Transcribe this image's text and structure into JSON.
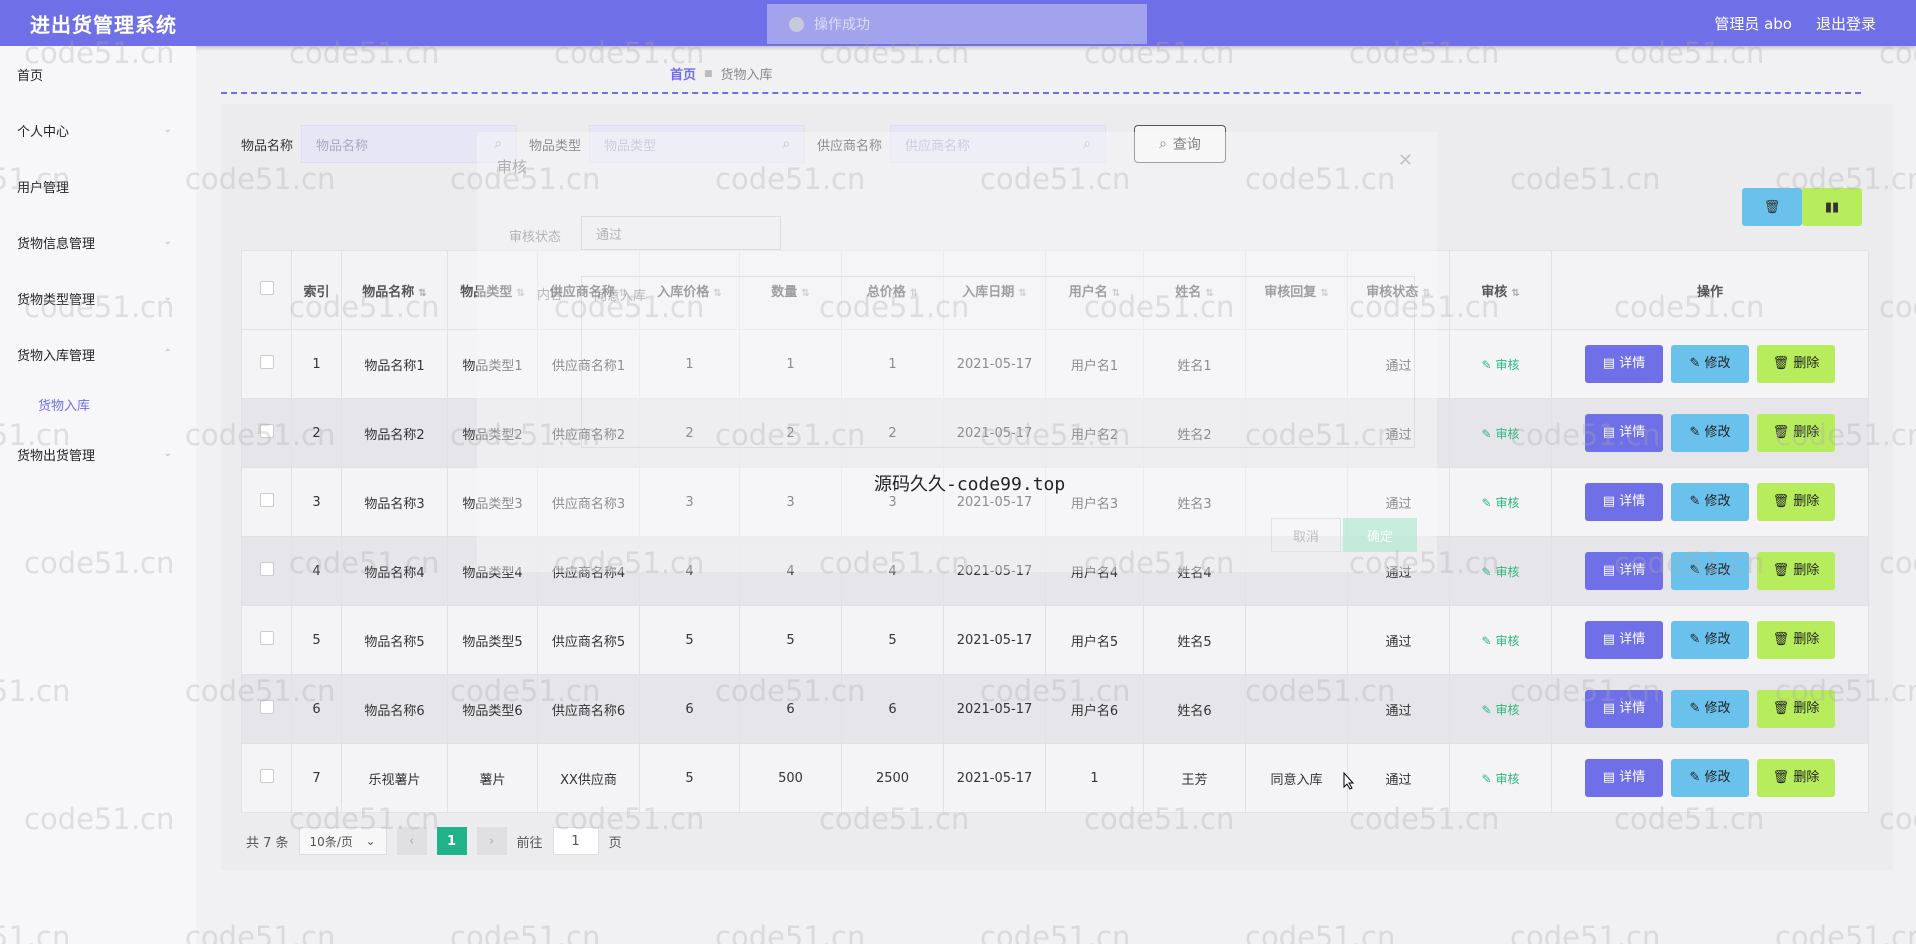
{
  "header": {
    "title": "进出货管理系统",
    "toast": "操作成功",
    "user": "管理员 abo",
    "logout": "退出登录"
  },
  "sidebar": {
    "items": [
      {
        "label": "首页",
        "chev": false
      },
      {
        "label": "个人中心",
        "chev": true
      },
      {
        "label": "用户管理",
        "chev": false
      },
      {
        "label": "货物信息管理",
        "chev": true
      },
      {
        "label": "货物类型管理",
        "chev": true
      },
      {
        "label": "货物入库管理",
        "chev": true
      },
      {
        "label": "货物出货管理",
        "chev": true
      }
    ],
    "active_sub": "货物入库"
  },
  "breadcrumb": {
    "home": "首页",
    "current": "货物入库"
  },
  "search": {
    "name_label": "物品名称",
    "name_placeholder": "物品名称",
    "type_label": "物品类型",
    "type_placeholder": "物品类型",
    "supplier_label": "供应商名称",
    "supplier_placeholder": "供应商名称",
    "query": "查询"
  },
  "table": {
    "headers": [
      "索引",
      "物品名称",
      "物品类型",
      "供应商名称",
      "入库价格",
      "数量",
      "总价格",
      "入库日期",
      "用户名",
      "姓名",
      "审核回复",
      "审核状态",
      "审核",
      "操作"
    ],
    "rows": [
      {
        "idx": "1",
        "name": "物品名称1",
        "type": "物品类型1",
        "supplier": "供应商名称1",
        "price": "1",
        "qty": "1",
        "total": "1",
        "date": "2021-05-17",
        "user": "用户名1",
        "realname": "姓名1",
        "reply": "",
        "status": "通过"
      },
      {
        "idx": "2",
        "name": "物品名称2",
        "type": "物品类型2",
        "supplier": "供应商名称2",
        "price": "2",
        "qty": "2",
        "total": "2",
        "date": "2021-05-17",
        "user": "用户名2",
        "realname": "姓名2",
        "reply": "",
        "status": "通过"
      },
      {
        "idx": "3",
        "name": "物品名称3",
        "type": "物品类型3",
        "supplier": "供应商名称3",
        "price": "3",
        "qty": "3",
        "total": "3",
        "date": "2021-05-17",
        "user": "用户名3",
        "realname": "姓名3",
        "reply": "",
        "status": "通过"
      },
      {
        "idx": "4",
        "name": "物品名称4",
        "type": "物品类型4",
        "supplier": "供应商名称4",
        "price": "4",
        "qty": "4",
        "total": "4",
        "date": "2021-05-17",
        "user": "用户名4",
        "realname": "姓名4",
        "reply": "",
        "status": "通过"
      },
      {
        "idx": "5",
        "name": "物品名称5",
        "type": "物品类型5",
        "supplier": "供应商名称5",
        "price": "5",
        "qty": "5",
        "total": "5",
        "date": "2021-05-17",
        "user": "用户名5",
        "realname": "姓名5",
        "reply": "",
        "status": "通过"
      },
      {
        "idx": "6",
        "name": "物品名称6",
        "type": "物品类型6",
        "supplier": "供应商名称6",
        "price": "6",
        "qty": "6",
        "total": "6",
        "date": "2021-05-17",
        "user": "用户名6",
        "realname": "姓名6",
        "reply": "",
        "status": "通过"
      },
      {
        "idx": "7",
        "name": "乐视薯片",
        "type": "薯片",
        "supplier": "XX供应商",
        "price": "5",
        "qty": "500",
        "total": "2500",
        "date": "2021-05-17",
        "user": "1",
        "realname": "王芳",
        "reply": "同意入库",
        "status": "通过"
      }
    ],
    "audit_link": "审核",
    "btn_detail": "详情",
    "btn_edit": "修改",
    "btn_delete": "删除"
  },
  "pager": {
    "total": "共 7 条",
    "size": "10条/页",
    "page": "1",
    "goto_prefix": "前往",
    "goto_value": "1",
    "goto_suffix": "页"
  },
  "modal": {
    "title": "审核",
    "status_label": "审核状态",
    "status_value": "通过",
    "content_label": "内容",
    "content_value": "同意入库",
    "cancel": "取消",
    "ok": "确定"
  },
  "watermarks": {
    "text": "code51.cn",
    "center": "源码久久-code99.top"
  }
}
